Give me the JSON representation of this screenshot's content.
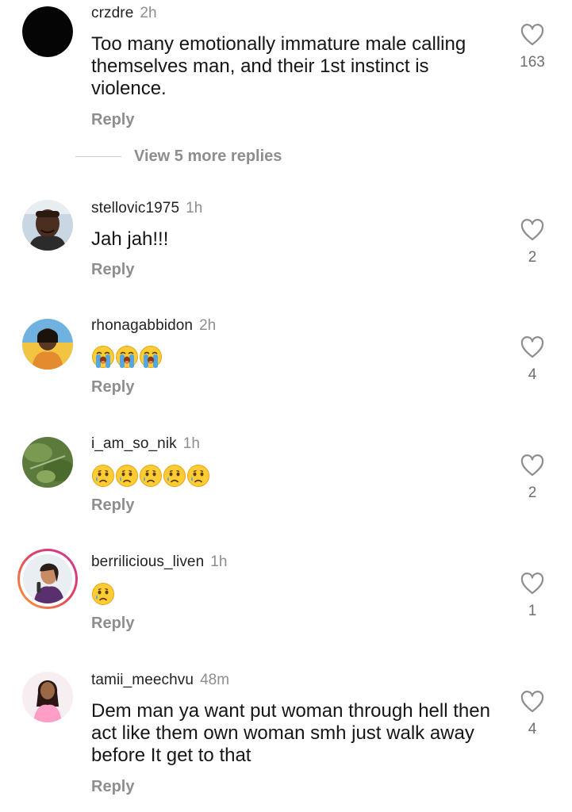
{
  "comments": [
    {
      "username": "crzdre",
      "time": "2h",
      "text": "Too many emotionally immature male calling themselves man, and their 1st instinct is violence.",
      "reply_label": "Reply",
      "likes": "163"
    },
    {
      "username": "stellovic1975",
      "time": "1h",
      "text": "Jah jah!!!",
      "reply_label": "Reply",
      "likes": "2"
    },
    {
      "username": "rhonagabbidon",
      "time": "2h",
      "emojis": [
        "loudly-crying-face",
        "loudly-crying-face",
        "loudly-crying-face"
      ],
      "reply_label": "Reply",
      "likes": "4"
    },
    {
      "username": "i_am_so_nik",
      "time": "1h",
      "emojis": [
        "crying-face",
        "crying-face",
        "crying-face",
        "crying-face",
        "crying-face"
      ],
      "reply_label": "Reply",
      "likes": "2"
    },
    {
      "username": "berrilicious_liven",
      "time": "1h",
      "emojis": [
        "crying-face"
      ],
      "reply_label": "Reply",
      "likes": "1"
    },
    {
      "username": "tamii_meechvu",
      "time": "48m",
      "text": "Dem man ya want put woman through hell then act like them own woman smh  just walk away before It get to that",
      "reply_label": "Reply",
      "likes": "4"
    }
  ],
  "view_more_replies": "View 5 more replies",
  "icons": {
    "like": "heart-outline-icon"
  },
  "colors": {
    "secondary_text": "#8e8e8e",
    "story_ring_start": "#f9a13a",
    "story_ring_end": "#c83aa6"
  }
}
